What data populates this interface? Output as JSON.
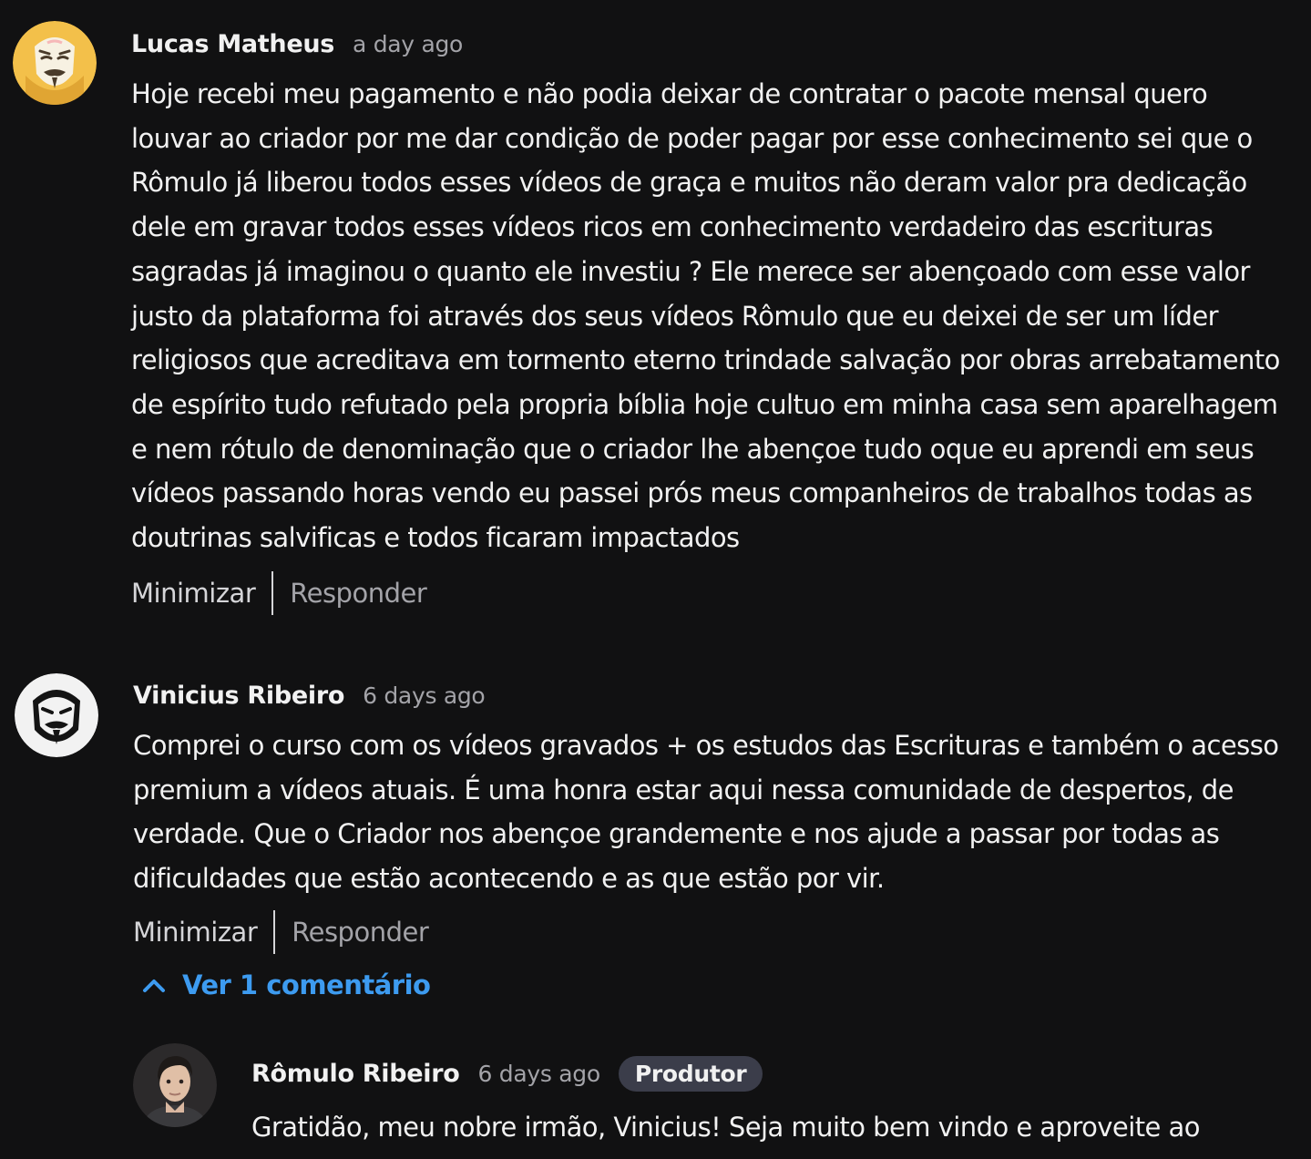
{
  "comments": [
    {
      "author": "Lucas Matheus",
      "time": "a day ago",
      "text": "Hoje recebi meu pagamento e não podia deixar de contratar o pacote mensal quero louvar ao criador por me dar condição de poder pagar por esse conhecimento sei que o Rômulo já liberou todos esses vídeos de graça e muitos não deram valor pra dedicação dele em gravar todos esses vídeos ricos em conhecimento verdadeiro das escrituras sagradas já imaginou o quanto ele investiu ? Ele merece ser abençoado com esse valor justo da plataforma foi através dos seus vídeos Rômulo que eu deixei de ser um líder religiosos que acreditava em tormento eterno trindade salvação por obras arrebatamento de espírito tudo refutado pela propria bíblia hoje cultuo em minha casa sem aparelhagem e nem rótulo de denominação que o criador lhe abençoe tudo oque eu aprendi em seus vídeos passando horas vendo eu passei prós meus companheiros de trabalhos todas as doutrinas salvificas e todos ficaram impactados",
      "avatar_icon": "anonymous-mask-yellow-icon",
      "minimize_label": "Minimizar",
      "reply_label": "Responder"
    },
    {
      "author": "Vinicius Ribeiro",
      "time": "6 days ago",
      "text": "Comprei o curso com os vídeos gravados + os estudos das Escrituras e também o acesso premium a vídeos atuais.  É uma honra estar aqui nessa comunidade de despertos, de verdade. Que o Criador nos abençoe grandemente e nos ajude a passar por todas as dificuldades que estão acontecendo e as que estão por vir.",
      "avatar_icon": "anonymous-mask-bw-icon",
      "minimize_label": "Minimizar",
      "reply_label": "Responder",
      "replies_toggle_label": "Ver 1 comentário",
      "replies": [
        {
          "author": "Rômulo Ribeiro",
          "time": "6 days ago",
          "badge": "Produtor",
          "text": "Gratidão, meu nobre irmão, Vinicius! Seja muito bem vindo e aproveite ao",
          "avatar_icon": "profile-photo-icon"
        }
      ]
    }
  ],
  "colors": {
    "background": "#111112",
    "text": "#f1f1f1",
    "muted": "#a3a3a8",
    "link": "#3d9bf0",
    "badge_bg": "#3b3d4a"
  }
}
